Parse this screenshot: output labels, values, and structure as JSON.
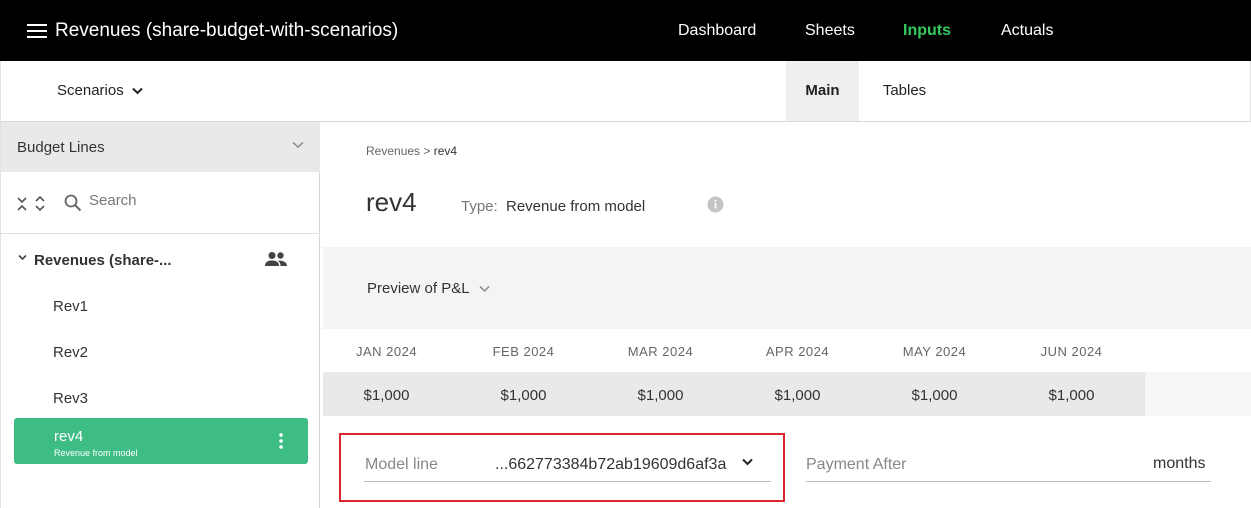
{
  "header": {
    "title": "Revenues (share-budget-with-scenarios)",
    "nav": [
      "Dashboard",
      "Sheets",
      "Inputs",
      "Actuals"
    ],
    "active_nav": "Inputs",
    "accent_color": "#36c95f"
  },
  "subbar": {
    "scenarios_label": "Scenarios",
    "tabs": [
      "Main",
      "Tables"
    ],
    "active_tab": "Main"
  },
  "sidebar": {
    "header": "Budget Lines",
    "search_placeholder": "Search",
    "group": {
      "label": "Revenues (share-...",
      "icon": "people-icon"
    },
    "items": [
      "Rev1",
      "Rev2",
      "Rev3"
    ],
    "active_item": {
      "label": "rev4",
      "sub": "Revenue from model"
    },
    "active_color": "#3dbd84"
  },
  "main": {
    "breadcrumb": {
      "parent": "Revenues",
      "separator": ">",
      "current": "rev4"
    },
    "title": "rev4",
    "type_label": "Type:",
    "type_value": "Revenue from model",
    "preview_label": "Preview of P&L",
    "months": [
      "JAN 2024",
      "FEB 2024",
      "MAR 2024",
      "APR 2024",
      "MAY 2024",
      "JUN 2024"
    ],
    "values": [
      "$1,000",
      "$1,000",
      "$1,000",
      "$1,000",
      "$1,000",
      "$1,000"
    ],
    "model_line_label": "Model line",
    "model_line_value": "...662773384b72ab19609d6af3a",
    "payment_after_label": "Payment After",
    "payment_after_value": "",
    "payment_unit": "months",
    "highlight_color": "#d9262e"
  }
}
